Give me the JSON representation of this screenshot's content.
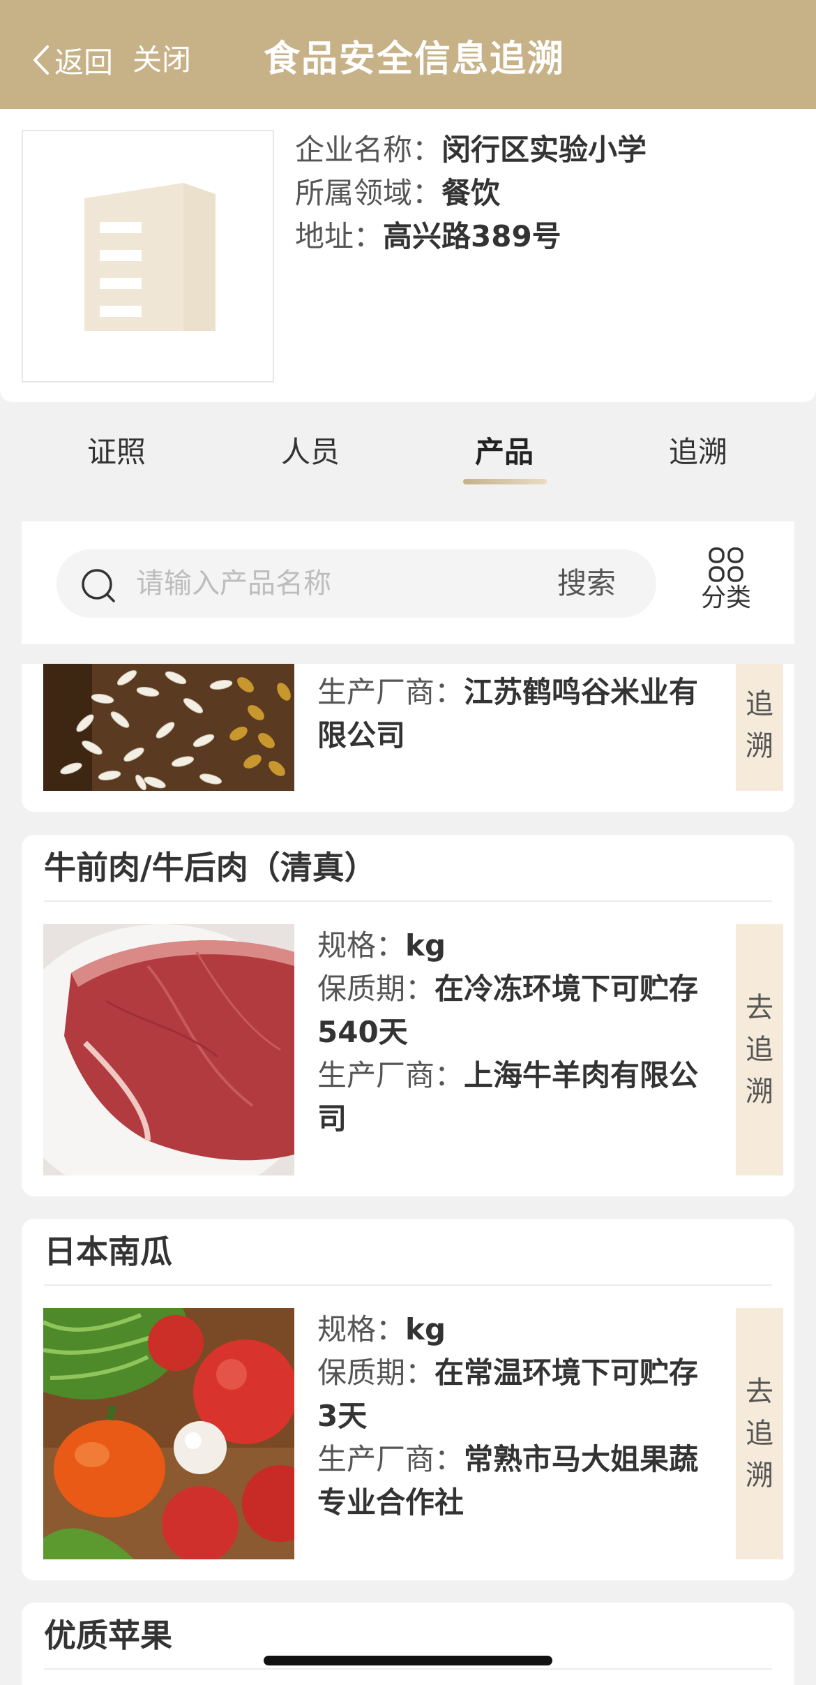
{
  "nav": {
    "back_label": "返回",
    "close_label": "关闭",
    "title": "食品安全信息追溯",
    "bg_color": "#c7b187"
  },
  "company": {
    "name_label": "企业名称：",
    "name": "闵行区实验小学",
    "domain_label": "所属领域：",
    "domain": "餐饮",
    "address_label": "地址：",
    "address": "高兴路389号"
  },
  "tabs": [
    {
      "label": "证照",
      "active": false
    },
    {
      "label": "人员",
      "active": false
    },
    {
      "label": "产品",
      "active": true
    },
    {
      "label": "追溯",
      "active": false
    }
  ],
  "search": {
    "placeholder": "请输入产品名称",
    "button_label": "搜索",
    "category_label": "分类"
  },
  "products": [
    {
      "maker_label": "生产厂商：",
      "maker_line1": "江苏鹤鸣谷米业有",
      "maker_line2": "限公司",
      "trace_partial": [
        "追",
        "溯"
      ]
    },
    {
      "name": "牛前肉/牛后肉（清真）",
      "spec_label": "规格：",
      "spec": "kg",
      "shelf_label": "保质期：",
      "shelf_line1": "在冷冻环境下可贮存",
      "shelf_line2": "540天",
      "maker_label": "生产厂商：",
      "maker_line1": "上海牛羊肉有限公",
      "maker_line2": "司",
      "trace": [
        "去",
        "追",
        "溯"
      ]
    },
    {
      "name": "日本南瓜",
      "spec_label": "规格：",
      "spec": "kg",
      "shelf_label": "保质期：",
      "shelf_line1": "在常温环境下可贮存",
      "shelf_line2": "3天",
      "maker_label": "生产厂商：",
      "maker_line1": "常熟市马大姐果蔬",
      "maker_line2": "专业合作社",
      "trace": [
        "去",
        "追",
        "溯"
      ]
    },
    {
      "name": "优质苹果"
    }
  ]
}
